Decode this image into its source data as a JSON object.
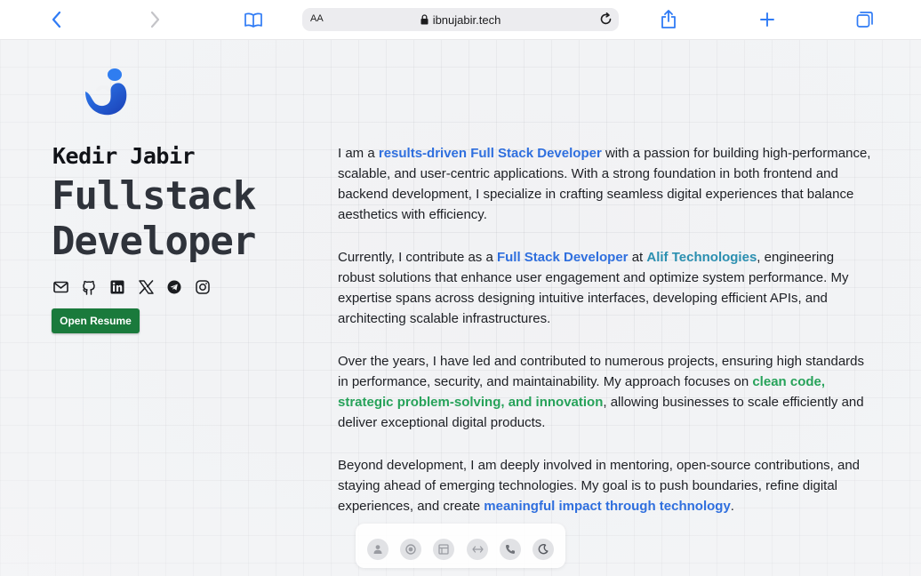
{
  "browser": {
    "aa_label": "AA",
    "url": "ibnujabir.tech",
    "icons": [
      "back-chevron-icon",
      "forward-chevron-icon",
      "bookmarks-book-icon",
      "lock-icon",
      "reload-icon",
      "share-icon",
      "new-tab-plus-icon",
      "tabs-overview-icon"
    ]
  },
  "profile": {
    "name": "Kedir Jabir",
    "role_line1": "Fullstack",
    "role_line2": "Developer",
    "resume_label": "Open Resume",
    "social_icons": [
      "email-icon",
      "github-icon",
      "linkedin-icon",
      "x-twitter-icon",
      "telegram-icon",
      "instagram-icon"
    ]
  },
  "about": {
    "p1_a": "I am a ",
    "p1_hl": "results-driven Full Stack Developer",
    "p1_b": " with a passion for building high-performance, scalable, and user-centric applications. With a strong foundation in both frontend and backend development, I specialize in crafting seamless digital experiences that balance aesthetics with efficiency.",
    "p2_a": "Currently, I contribute as a ",
    "p2_hl1": "Full Stack Developer",
    "p2_b": " at ",
    "p2_hl2": "Alif Technologies",
    "p2_c": ", engineering robust solutions that enhance user engagement and optimize system performance. My expertise spans across designing intuitive interfaces, developing efficient APIs, and architecting scalable infrastructures.",
    "p3_a": "Over the years, I have led and contributed to numerous projects, ensuring high standards in performance, security, and maintainability. My approach focuses on ",
    "p3_hl": "clean code, strategic problem-solving, and innovation",
    "p3_b": ", allowing businesses to scale efficiently and deliver exceptional digital products.",
    "p4_a": "Beyond development, I am deeply involved in mentoring, open-source contributions, and staying ahead of emerging technologies. My goal is to push boundaries, refine digital experiences, and create ",
    "p4_hl": "meaningful impact through technology",
    "p4_b": "."
  },
  "dock": {
    "icons": [
      "user-icon",
      "skills-badge-icon",
      "projects-icon",
      "code-arrows-icon",
      "phone-icon",
      "dark-mode-moon-icon"
    ]
  },
  "colors": {
    "accent_blue": "#2f6fde",
    "accent_teal": "#2b8fb0",
    "accent_green": "#27a25a",
    "button_green": "#1a7a3c",
    "logo_blue": "#1e5fd8"
  }
}
